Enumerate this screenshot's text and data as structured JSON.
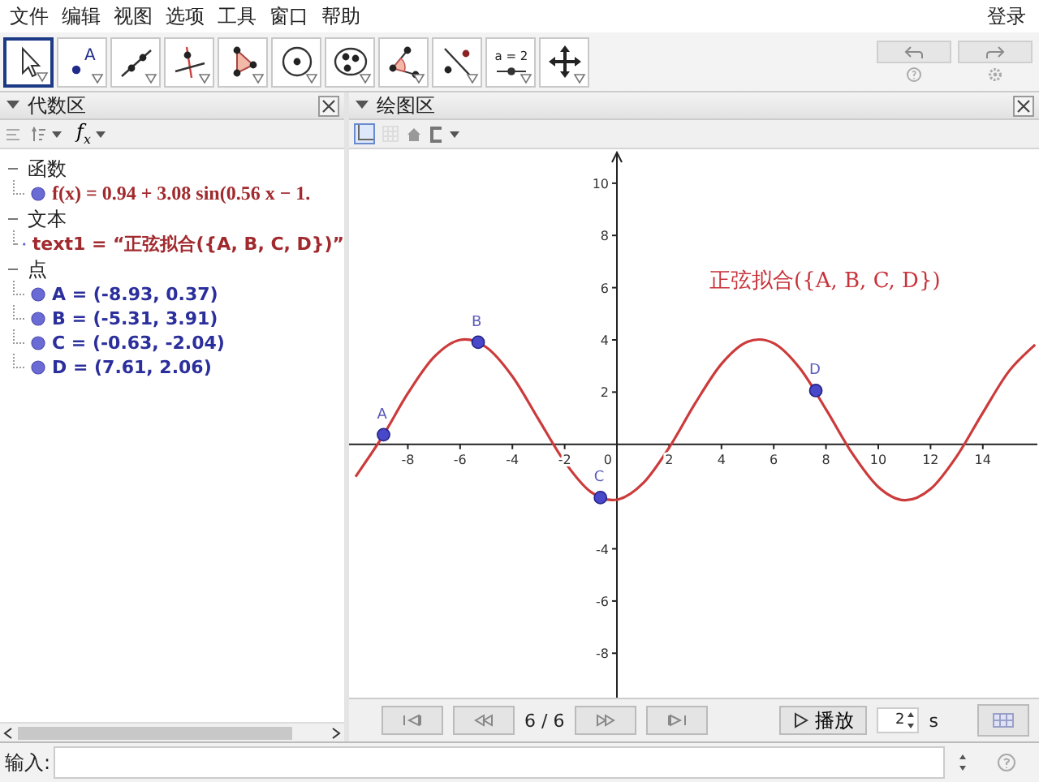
{
  "menu": {
    "items": [
      "文件",
      "编辑",
      "视图",
      "选项",
      "工具",
      "窗口",
      "帮助"
    ],
    "login": "登录"
  },
  "toolbar": {
    "tools": [
      {
        "kind": "move",
        "selected": true
      },
      {
        "kind": "point",
        "label": "A",
        "selected": false
      },
      {
        "kind": "line",
        "selected": false
      },
      {
        "kind": "perpendicular",
        "selected": false
      },
      {
        "kind": "polygon",
        "selected": false
      },
      {
        "kind": "circle",
        "selected": false
      },
      {
        "kind": "conic",
        "selected": false
      },
      {
        "kind": "angle",
        "selected": false
      },
      {
        "kind": "reflect",
        "selected": false
      },
      {
        "kind": "slider",
        "label": "a = 2",
        "selected": false
      },
      {
        "kind": "move-view",
        "selected": false
      }
    ]
  },
  "algebra": {
    "title": "代数区",
    "input_toggle": "f$_{x}$",
    "groups": [
      {
        "label": "函数",
        "kind": "function",
        "expanded": true,
        "children": [
          {
            "text": "f(x) = 0.94 + 3.08 sin(0.56 x − 1."
          }
        ]
      },
      {
        "label": "文本",
        "kind": "text",
        "expanded": true,
        "children": [
          {
            "text": "text1 = “正弦拟合({A, B, C, D})”"
          }
        ]
      },
      {
        "label": "点",
        "kind": "point",
        "expanded": true,
        "children": [
          {
            "text": "A = (-8.93, 0.37)"
          },
          {
            "text": "B = (-5.31, 3.91)"
          },
          {
            "text": "C = (-0.63, -2.04)"
          },
          {
            "text": "D = (7.61, 2.06)"
          }
        ]
      }
    ]
  },
  "graphics": {
    "title": "绘图区",
    "text": "正弦拟合({A, B, C, D})",
    "chart_data": {
      "type": "line",
      "xlim": [
        -10.25,
        16.15
      ],
      "ylim": [
        -9.7,
        11.3
      ],
      "xticks": [
        -8,
        -6,
        -4,
        -2,
        2,
        4,
        6,
        8,
        10,
        12,
        14
      ],
      "yticks": [
        -8,
        -6,
        -4,
        2,
        4,
        6,
        8,
        10
      ],
      "x": [
        -10,
        -9,
        -8,
        -7,
        -6,
        -5,
        -4,
        -3,
        -2,
        -1,
        0,
        1,
        2,
        3,
        4,
        5,
        6,
        7,
        8,
        9,
        10,
        11,
        12,
        13,
        14,
        15,
        16
      ],
      "series": [
        {
          "color": "#cc3b3b",
          "values": [
            -1.24,
            0.25,
            1.95,
            3.34,
            4.0,
            3.72,
            2.6,
            0.96,
            -0.67,
            -1.82,
            -2.12,
            -1.49,
            -0.12,
            1.58,
            3.08,
            3.93,
            3.87,
            2.91,
            1.34,
            -0.34,
            -1.63,
            -2.14,
            -1.71,
            -0.46,
            1.21,
            2.8,
            3.82
          ]
        }
      ],
      "annotations": [
        {
          "text": "A",
          "x": -8.93,
          "y": 0.37
        },
        {
          "text": "B",
          "x": -5.31,
          "y": 3.91
        },
        {
          "text": "C",
          "x": -0.63,
          "y": -2.04
        },
        {
          "text": "D",
          "x": 7.61,
          "y": 2.06
        }
      ]
    },
    "origin_label": "0",
    "playback": {
      "position": "6 / 6",
      "play": "播放",
      "speed": "2",
      "unit": "s"
    }
  },
  "input_bar": {
    "label": "输入:"
  }
}
